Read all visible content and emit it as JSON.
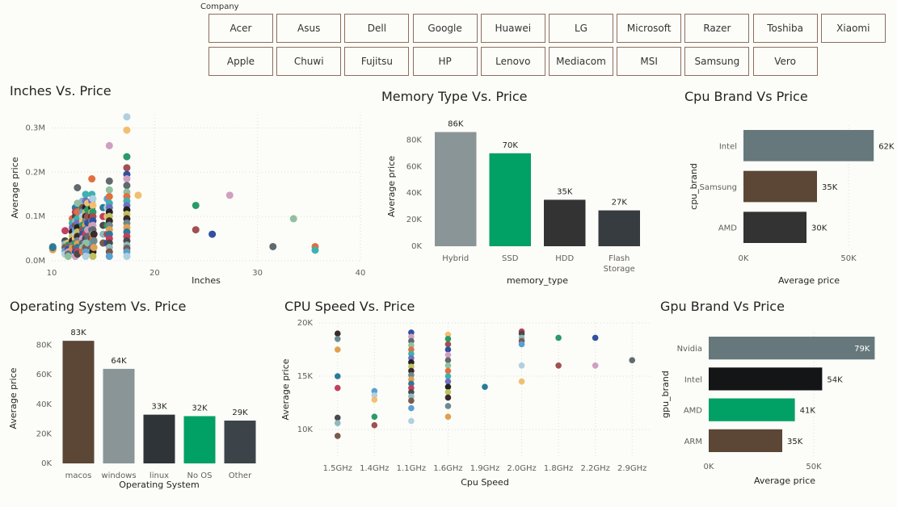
{
  "slicer": {
    "title": "Company",
    "rows": [
      [
        "Acer",
        "Asus",
        "Dell",
        "Google",
        "Huawei",
        "LG",
        "Microsoft",
        "Razer",
        "Toshiba",
        "Xiaomi"
      ],
      [
        "Apple",
        "Chuwi",
        "Fujitsu",
        "HP",
        "Lenovo",
        "Mediacom",
        "MSI",
        "Samsung",
        "Vero"
      ]
    ]
  },
  "chart_data": [
    {
      "id": "inches",
      "type": "scatter",
      "title": "Inches Vs. Price",
      "xlabel": "Inches",
      "ylabel": "Average price",
      "xlim": [
        10,
        40
      ],
      "ylim": [
        0,
        330000
      ],
      "xticks": [
        {
          "v": 10,
          "l": "10"
        },
        {
          "v": 20,
          "l": "20"
        },
        {
          "v": 30,
          "l": "30"
        },
        {
          "v": 40,
          "l": "40"
        }
      ],
      "yticks": [
        {
          "v": 0,
          "l": "0.0M"
        },
        {
          "v": 100000,
          "l": "0.1M"
        },
        {
          "v": 200000,
          "l": "0.2M"
        },
        {
          "v": 300000,
          "l": "0.3M"
        }
      ],
      "grid": true,
      "columns": [
        {
          "x": 10.1,
          "ys": [
            28000,
            32000,
            25000,
            30000
          ]
        },
        {
          "x": 11.3,
          "ys": [
            68000,
            45000,
            38000,
            30000,
            22000,
            15000
          ]
        },
        {
          "x": 11.6,
          "ys": [
            40000,
            35000,
            30000,
            25000,
            20000,
            15000,
            10000
          ]
        },
        {
          "x": 12.0,
          "ys": [
            95000,
            85000,
            75000,
            65000,
            55000,
            45000,
            35000,
            28000
          ]
        },
        {
          "x": 12.3,
          "ys": [
            120000,
            110000,
            100000,
            90000,
            80000,
            70000,
            60000,
            50000,
            40000,
            30000,
            20000,
            10000
          ]
        },
        {
          "x": 12.5,
          "ys": [
            165000,
            130000,
            110000,
            95000,
            85000,
            75000,
            65000,
            55000,
            45000,
            38000,
            30000,
            22000,
            15000
          ]
        },
        {
          "x": 13.0,
          "ys": [
            135000,
            120000,
            110000,
            100000,
            90000,
            80000,
            70000,
            60000,
            50000,
            40000,
            30000,
            20000
          ]
        },
        {
          "x": 13.3,
          "ys": [
            150000,
            135000,
            120000,
            110000,
            100000,
            90000,
            80000,
            70000,
            60000,
            50000,
            40000,
            30000,
            20000,
            10000
          ]
        },
        {
          "x": 13.5,
          "ys": [
            130000,
            115000,
            100000,
            85000,
            70000,
            55000,
            40000
          ]
        },
        {
          "x": 13.9,
          "ys": [
            185000,
            150000,
            135000,
            120000,
            110000,
            100000,
            90000,
            80000,
            70000,
            60000,
            50000,
            40000,
            30000,
            20000
          ]
        },
        {
          "x": 14.0,
          "ys": [
            140000,
            125000,
            110000,
            100000,
            90000,
            80000,
            70000,
            60000,
            50000,
            40000,
            30000,
            20000,
            10000
          ]
        },
        {
          "x": 14.1,
          "ys": [
            60000,
            45000,
            30000
          ]
        },
        {
          "x": 15.0,
          "ys": [
            120000,
            100000,
            80000,
            60000,
            40000
          ]
        },
        {
          "x": 15.4,
          "ys": [
            140000,
            120000,
            100000,
            80000,
            60000,
            40000
          ]
        },
        {
          "x": 15.6,
          "ys": [
            260000,
            180000,
            160000,
            145000,
            130000,
            120000,
            110000,
            100000,
            90000,
            80000,
            70000,
            60000,
            50000,
            40000,
            30000,
            20000,
            10000
          ]
        },
        {
          "x": 17.3,
          "ys": [
            325000,
            295000,
            235000,
            210000,
            195000,
            185000,
            170000,
            155000,
            145000,
            135000,
            125000,
            115000,
            105000,
            95000,
            85000,
            75000,
            65000,
            55000,
            45000,
            35000,
            28000,
            20000,
            10000
          ]
        },
        {
          "x": 18.4,
          "ys": [
            148000
          ]
        },
        {
          "x": 24.0,
          "ys": [
            125000,
            70000
          ]
        },
        {
          "x": 25.6,
          "ys": [
            60000
          ]
        },
        {
          "x": 27.3,
          "ys": [
            148000
          ]
        },
        {
          "x": 31.5,
          "ys": [
            32000
          ]
        },
        {
          "x": 33.5,
          "ys": [
            95000
          ]
        },
        {
          "x": 35.6,
          "ys": [
            32000,
            24000
          ]
        }
      ]
    },
    {
      "id": "memory",
      "type": "bar",
      "title": "Memory Type Vs. Price",
      "xlabel": "memory_type",
      "ylabel": "Average price",
      "ylim": [
        0,
        90000
      ],
      "yticks": [
        {
          "v": 0,
          "l": "0K"
        },
        {
          "v": 20000,
          "l": "20K"
        },
        {
          "v": 40000,
          "l": "40K"
        },
        {
          "v": 60000,
          "l": "60K"
        },
        {
          "v": 80000,
          "l": "80K"
        }
      ],
      "categories": [
        [
          "Hybrid"
        ],
        [
          "SSD"
        ],
        [
          "HDD"
        ],
        [
          "Flash",
          "Storage"
        ]
      ],
      "values": [
        86000,
        70000,
        35000,
        27000
      ],
      "labels": [
        "86K",
        "70K",
        "35K",
        "27K"
      ],
      "colors": [
        "#8a9598",
        "#01a064",
        "#333333",
        "#373c40"
      ]
    },
    {
      "id": "cpu_brand",
      "type": "hbar",
      "title": "Cpu Brand Vs Price",
      "xlabel": "Average price",
      "ylabel": "cpu_brand",
      "xlim": [
        0,
        70000
      ],
      "xticks": [
        {
          "v": 0,
          "l": "0K"
        },
        {
          "v": 50000,
          "l": "50K"
        }
      ],
      "categories": [
        "Intel",
        "Samsung",
        "AMD"
      ],
      "values": [
        62000,
        35000,
        30000
      ],
      "labels": [
        "62K",
        "35K",
        "30K"
      ],
      "colors": [
        "#66787b",
        "#5c4636",
        "#333333"
      ]
    },
    {
      "id": "os",
      "type": "bar",
      "title": "Operating System Vs. Price",
      "xlabel": "Operating System",
      "ylabel": "Average price",
      "ylim": [
        0,
        88000
      ],
      "yticks": [
        {
          "v": 0,
          "l": "0K"
        },
        {
          "v": 20000,
          "l": "20K"
        },
        {
          "v": 40000,
          "l": "40K"
        },
        {
          "v": 60000,
          "l": "60K"
        },
        {
          "v": 80000,
          "l": "80K"
        }
      ],
      "categories": [
        [
          "macos"
        ],
        [
          "windows"
        ],
        [
          "linux"
        ],
        [
          "No OS"
        ],
        [
          "Other"
        ]
      ],
      "values": [
        83000,
        64000,
        33000,
        32000,
        29000
      ],
      "labels": [
        "83K",
        "64K",
        "33K",
        "32K",
        "29K"
      ],
      "colors": [
        "#5c4636",
        "#8a9598",
        "#2f3439",
        "#01a064",
        "#3d4449"
      ]
    },
    {
      "id": "cpu_speed",
      "type": "scatter",
      "title": "CPU Speed Vs. Price",
      "xlabel": "Cpu Speed",
      "ylabel": "Average price",
      "categories": [
        "1.5GHz",
        "1.4GHz",
        "1.1GHz",
        "1.6GHz",
        "1.9GHz",
        "2.0GHz",
        "1.8GHz",
        "2.2GHz",
        "2.9GHz"
      ],
      "ylim": [
        7500,
        20000
      ],
      "yticks": [
        {
          "v": 10000,
          "l": "10K"
        },
        {
          "v": 15000,
          "l": "15K"
        },
        {
          "v": 20000,
          "l": "20K"
        }
      ],
      "grid": true,
      "columns": [
        {
          "c": 0,
          "ys": [
            19000,
            18500,
            17500,
            15000,
            13900,
            11100,
            10600,
            9400
          ]
        },
        {
          "c": 1,
          "ys": [
            13600,
            13200,
            12800,
            11200,
            10400
          ]
        },
        {
          "c": 2,
          "ys": [
            19100,
            18700,
            18300,
            17900,
            17500,
            17100,
            16700,
            16300,
            15900,
            15500,
            15100,
            14700,
            14300,
            13900,
            13500,
            13100,
            12700,
            12000,
            10800
          ]
        },
        {
          "c": 3,
          "ys": [
            18900,
            18500,
            18000,
            17500,
            17000,
            16500,
            16000,
            15500,
            15000,
            14500,
            14000,
            13500,
            13000,
            12200,
            11200
          ]
        },
        {
          "c": 4,
          "ys": [
            14000
          ]
        },
        {
          "c": 5,
          "ys": [
            19200,
            19000,
            18600,
            18300,
            18000,
            16000,
            14500
          ]
        },
        {
          "c": 6,
          "ys": [
            18600,
            16000
          ]
        },
        {
          "c": 7,
          "ys": [
            18600,
            16000
          ]
        },
        {
          "c": 8,
          "ys": [
            16500
          ]
        }
      ]
    },
    {
      "id": "gpu_brand",
      "type": "hbar",
      "title": "Gpu Brand Vs Price",
      "xlabel": "Average price",
      "ylabel": "gpu_brand",
      "xlim": [
        0,
        80000
      ],
      "xticks": [
        {
          "v": 0,
          "l": "0K"
        },
        {
          "v": 50000,
          "l": "50K"
        }
      ],
      "categories": [
        "Nvidia",
        "Intel",
        "AMD",
        "ARM"
      ],
      "values": [
        79000,
        54000,
        41000,
        35000
      ],
      "labels": [
        "79K",
        "54K",
        "41K",
        "35K"
      ],
      "colors": [
        "#66787b",
        "#131516",
        "#01a064",
        "#5c4636"
      ],
      "labelInsideFirst": true
    }
  ]
}
